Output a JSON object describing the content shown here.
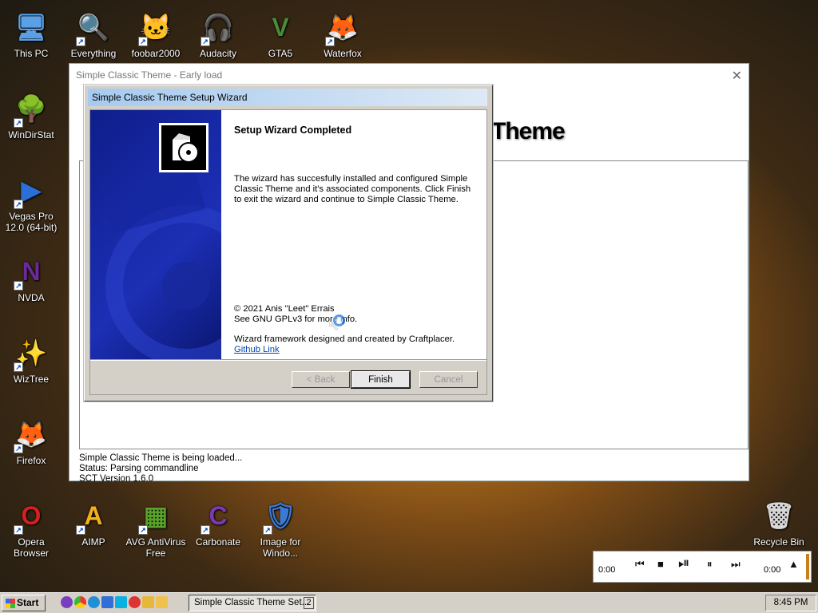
{
  "desktop_icons": [
    {
      "label": "This PC",
      "glyph": "🖥",
      "icon": "computer-icon",
      "shortcut": false
    },
    {
      "label": "Everything",
      "glyph": "🔍",
      "icon": "everything-search-icon",
      "shortcut": true
    },
    {
      "label": "foobar2000",
      "glyph": "🐱",
      "icon": "foobar-icon",
      "shortcut": true
    },
    {
      "label": "Audacity",
      "glyph": "🎧",
      "icon": "audacity-icon",
      "shortcut": true
    },
    {
      "label": "GTA5",
      "glyph": "V",
      "icon": "gta5-icon",
      "shortcut": false
    },
    {
      "label": "Waterfox",
      "glyph": "🦊",
      "icon": "waterfox-icon",
      "shortcut": true
    },
    {
      "label": "WinDirStat",
      "glyph": "🌳",
      "icon": "windirstat-icon",
      "shortcut": true
    },
    {
      "label": "Vegas Pro 12.0 (64-bit)",
      "glyph": "▶",
      "icon": "vegas-pro-icon",
      "shortcut": true
    },
    {
      "label": "NVDA",
      "glyph": "N",
      "icon": "nvda-icon",
      "shortcut": true
    },
    {
      "label": "WizTree",
      "glyph": "✨",
      "icon": "wiztree-icon",
      "shortcut": true
    },
    {
      "label": "Firefox",
      "glyph": "🦊",
      "icon": "firefox-icon",
      "shortcut": true
    },
    {
      "label": "Opera Browser",
      "glyph": "O",
      "icon": "opera-icon",
      "shortcut": true
    },
    {
      "label": "AIMP",
      "glyph": "A",
      "icon": "aimp-icon",
      "shortcut": true
    },
    {
      "label": "AVG AntiVirus Free",
      "glyph": "▦",
      "icon": "avg-icon",
      "shortcut": true
    },
    {
      "label": "Carbonate",
      "glyph": "C",
      "icon": "carbonate-icon",
      "shortcut": true
    },
    {
      "label": "Image for Windo...",
      "glyph": "🛡",
      "icon": "image-for-windows-icon",
      "shortcut": true
    },
    {
      "label": "Recycle Bin",
      "glyph": "🗑",
      "icon": "recycle-bin-icon",
      "shortcut": false
    }
  ],
  "early_window": {
    "title": "Simple Classic Theme - Early load",
    "heading_fragment": "Theme",
    "status_lines": [
      "Simple Classic Theme is being loaded...",
      "Status: Parsing commandline",
      "SCT Version 1.6.0"
    ],
    "close_label": "✕"
  },
  "wizard": {
    "title": "Simple Classic Theme Setup Wizard",
    "heading": "Setup Wizard Completed",
    "body": "The wizard has succesfully installed and configured Simple Classic Theme and it's associated components. Click Finish to exit the wizard and continue to Simple Classic Theme.",
    "copyright": "© 2021 Anis \"Leet\" Errais",
    "license": "See GNU GPLv3 for more info.",
    "credits": "Wizard framework designed and created by Craftplacer.",
    "github_link": "Github Link",
    "back_label": "< Back",
    "finish_label": "Finish",
    "cancel_label": "Cancel"
  },
  "media_player": {
    "elapsed": "0:00",
    "total": "0:00"
  },
  "taskbar": {
    "start_label": "Start",
    "task_label": "Simple  Classic  Theme Set...",
    "task_count": "2",
    "clock": "8:45 PM"
  }
}
